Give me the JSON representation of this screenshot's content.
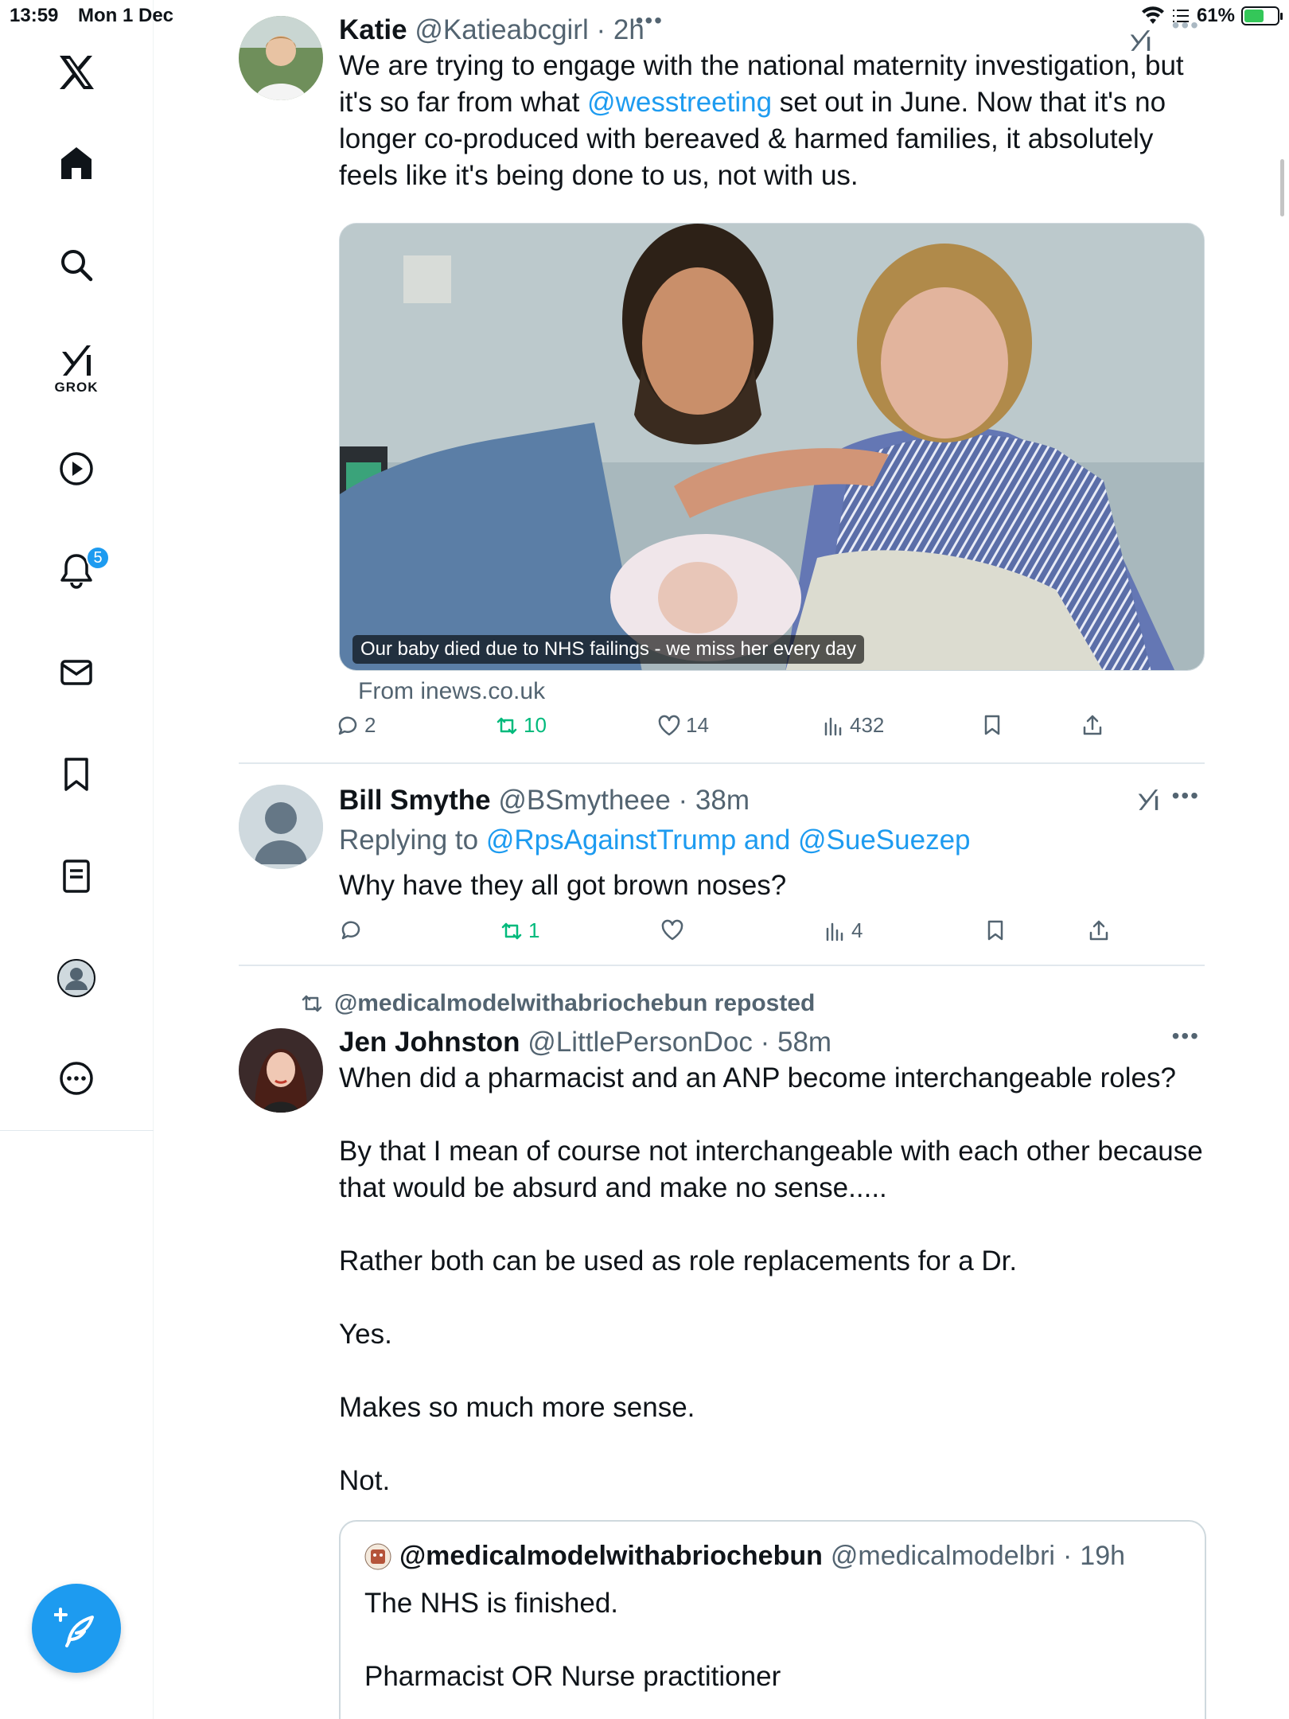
{
  "status_bar": {
    "time": "13:59",
    "date": "Mon 1 Dec",
    "battery": "61%",
    "battery_level": 0.61
  },
  "sidebar": {
    "grok_label": "GROK",
    "notifications_badge": "5",
    "items": [
      "x-logo-icon",
      "home-icon",
      "search-icon",
      "grok-icon",
      "video-icon",
      "bell-icon",
      "mail-icon",
      "bookmark-icon",
      "lists-icon",
      "profile-icon",
      "more-icon"
    ]
  },
  "colors": {
    "accent": "#1d9bf0",
    "secondary_text": "#536471",
    "repost_green": "#00ba7c",
    "border": "#e1e8ed"
  },
  "posts": [
    {
      "name": "Katie",
      "handle": "@Katieabcgirl",
      "time": "2h",
      "text_part1": "We are trying to engage with the national maternity investigation, but it's so far from what ",
      "mention": "@wesstreeting",
      "text_part2": " set out in June. Now that it's no longer co-produced with bereaved & harmed families, it absolutely feels like it's being done to us, not with us.",
      "media_caption": "Our baby died due to NHS failings - we miss her every day",
      "media_source": "From inews.co.uk",
      "replies": "2",
      "reposts": "10",
      "likes": "14",
      "views": "432"
    },
    {
      "name": "Bill Smythe",
      "handle": "@BSmytheee",
      "time": "38m",
      "replying_prefix": "Replying to ",
      "replying_to": "@RpsAgainstTrump and @SueSuezep",
      "text": "Why have they all got brown noses?",
      "replies": "",
      "reposts": "1",
      "likes": "",
      "views": "4"
    },
    {
      "reposted_by": "@medicalmodelwithabriochebun reposted",
      "name": "Jen Johnston",
      "handle": "@LittlePersonDoc",
      "time": "58m",
      "paragraphs": [
        "When did a pharmacist and an ANP become interchangeable roles?",
        "By that I mean of course not interchangeable with each other because that would be absurd and make no sense.....",
        "Rather both can be used as role replacements for a Dr.",
        "Yes.",
        "Makes so much more sense.",
        "Not."
      ],
      "quote": {
        "name": "@medicalmodelwithabriochebun",
        "handle": "@medicalmodelbri",
        "time": "19h",
        "line1": "The NHS is finished.",
        "line2": "Pharmacist OR Nurse practitioner"
      }
    }
  ]
}
